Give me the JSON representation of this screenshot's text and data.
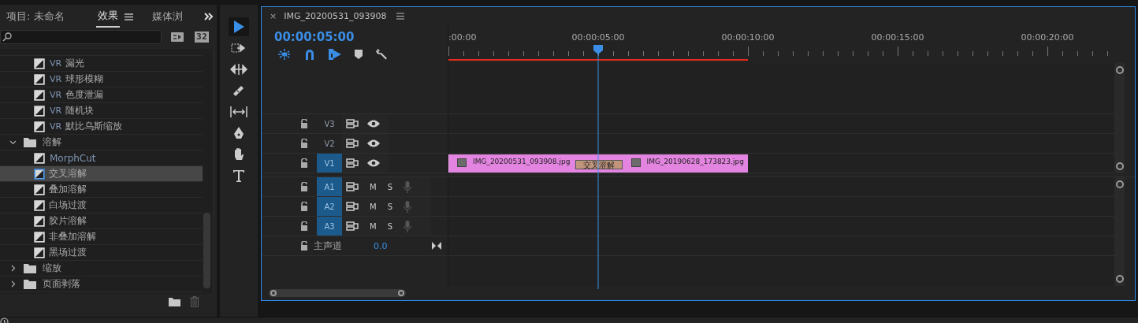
{
  "effects_panel": {
    "tabs": [
      {
        "label": "项目: 未命名",
        "selected": false
      },
      {
        "label": "效果",
        "selected": true
      },
      {
        "label": "媒体浏",
        "selected": false
      }
    ],
    "bit_badge": "32",
    "tree": [
      {
        "kind": "effect",
        "prefix": "VR",
        "name": "漏光",
        "selected": false,
        "accent": false
      },
      {
        "kind": "effect",
        "prefix": "VR",
        "name": "球形模糊",
        "selected": false,
        "accent": false
      },
      {
        "kind": "effect",
        "prefix": "VR",
        "name": "色度泄漏",
        "selected": false,
        "accent": false
      },
      {
        "kind": "effect",
        "prefix": "VR",
        "name": "随机块",
        "selected": false,
        "accent": false
      },
      {
        "kind": "effect",
        "prefix": "VR",
        "name": "默比乌斯缩放",
        "selected": false,
        "accent": false
      },
      {
        "kind": "folder",
        "name": "溶解",
        "expanded": true,
        "children": [
          {
            "kind": "effect",
            "name": "MorphCut",
            "selected": false,
            "accent": true
          },
          {
            "kind": "effect",
            "name": "交叉溶解",
            "selected": true,
            "accent": false
          },
          {
            "kind": "effect",
            "name": "叠加溶解",
            "selected": false,
            "accent": false
          },
          {
            "kind": "effect",
            "name": "白场过渡",
            "selected": false,
            "accent": false
          },
          {
            "kind": "effect",
            "name": "胶片溶解",
            "selected": false,
            "accent": false
          },
          {
            "kind": "effect",
            "name": "非叠加溶解",
            "selected": false,
            "accent": false
          },
          {
            "kind": "effect",
            "name": "黑场过渡",
            "selected": false,
            "accent": false
          }
        ]
      },
      {
        "kind": "folder",
        "name": "缩放",
        "expanded": false
      },
      {
        "kind": "folder",
        "name": "页面剥落",
        "expanded": false
      }
    ]
  },
  "tools": [
    {
      "kind": "select",
      "selected": true
    },
    {
      "kind": "track-select",
      "selected": false
    },
    {
      "kind": "ripple",
      "selected": false
    },
    {
      "kind": "razor",
      "selected": false
    },
    {
      "kind": "slip",
      "selected": false
    },
    {
      "kind": "pen",
      "selected": false
    },
    {
      "kind": "hand",
      "selected": false
    },
    {
      "kind": "type",
      "selected": false
    }
  ],
  "timeline": {
    "close": "×",
    "title": "IMG_20200531_093908",
    "timecode": "00:00:05:00",
    "toggles": [
      {
        "kind": "nest",
        "on": true
      },
      {
        "kind": "snap",
        "on": true
      },
      {
        "kind": "linked",
        "on": true
      },
      {
        "kind": "marker",
        "on": false
      },
      {
        "kind": "settings",
        "on": false
      }
    ],
    "ruler_labels": [
      ":00:00",
      "00:00:05:00",
      "00:00:10:00",
      "00:00:15:00",
      "00:00:20:00"
    ],
    "video_tracks": [
      {
        "name": "V3",
        "targeted": false
      },
      {
        "name": "V2",
        "targeted": false
      },
      {
        "name": "V1",
        "targeted": true
      }
    ],
    "audio_tracks": [
      {
        "name": "A1",
        "targeted": true,
        "mute": "M",
        "solo": "S"
      },
      {
        "name": "A2",
        "targeted": true,
        "mute": "M",
        "solo": "S"
      },
      {
        "name": "A3",
        "targeted": true,
        "mute": "M",
        "solo": "S"
      }
    ],
    "master": {
      "name": "主声道",
      "volume": "0.0"
    },
    "clips": [
      {
        "name": "IMG_20200531_093908.jpg"
      },
      {
        "name": "IMG_20190628_173823.jpg"
      }
    ],
    "transition": "交叉溶解"
  }
}
